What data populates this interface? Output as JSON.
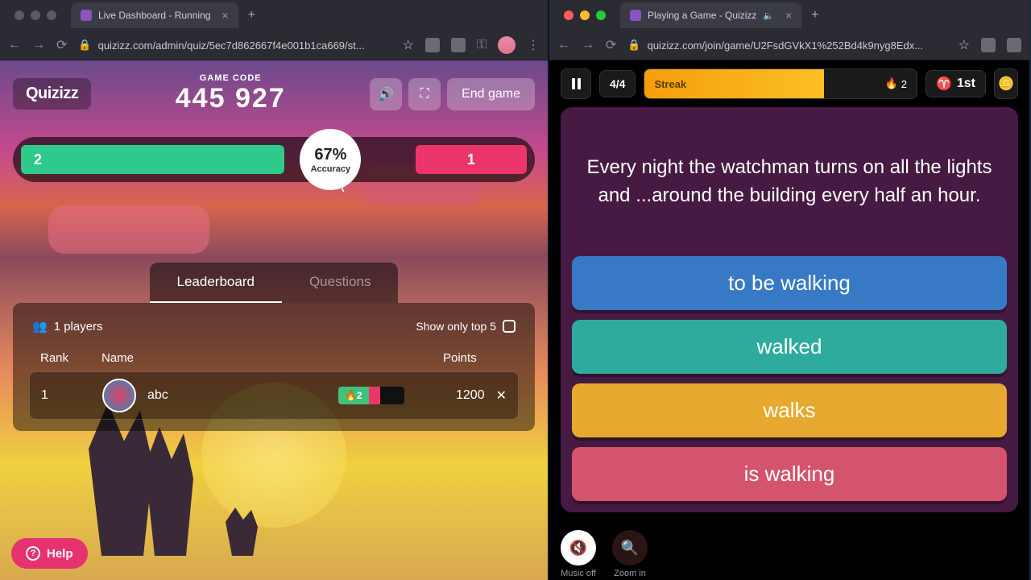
{
  "left": {
    "tab_title": "Live Dashboard - Running",
    "url": "quizizz.com/admin/quiz/5ec7d862667f4e001b1ca669/st...",
    "logo": "Quizizz",
    "game_code_label": "GAME CODE",
    "game_code": "445 927",
    "end_game": "End game",
    "accuracy_pct": "67%",
    "accuracy_label": "Accuracy",
    "correct_count": "2",
    "wrong_count": "1",
    "tabs": {
      "leaderboard": "Leaderboard",
      "questions": "Questions"
    },
    "players_label": "1 players",
    "show_top_label": "Show only top 5",
    "cols": {
      "rank": "Rank",
      "name": "Name",
      "points": "Points"
    },
    "row": {
      "rank": "1",
      "name": "abc",
      "streak": "2",
      "points": "1200"
    },
    "help": "Help"
  },
  "right": {
    "tab_title": "Playing a Game - Quizizz",
    "url": "quizizz.com/join/game/U2FsdGVkX1%252Bd4k9nyg8Edx...",
    "q_counter": "4/4",
    "streak_label": "Streak",
    "streak_count": "2",
    "rank": "1st",
    "question": "Every night the watchman turns on all the lights and ...around the building every half an hour.",
    "answers": [
      "to be walking",
      "walked",
      "walks",
      "is walking"
    ],
    "bottom": {
      "music": "Music off",
      "zoom": "Zoom in"
    }
  }
}
